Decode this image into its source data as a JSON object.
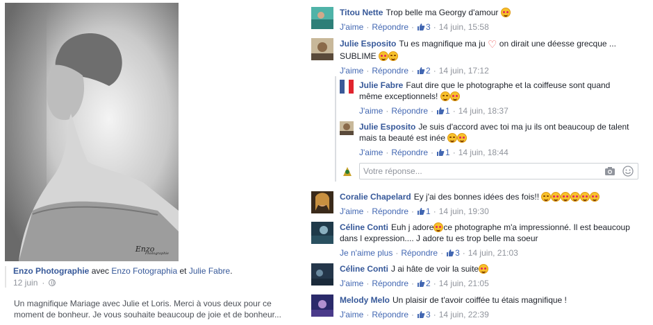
{
  "post": {
    "photo_signature": "Enzo",
    "photo_signature_small": "Photographie",
    "author": "Enzo Photographie",
    "with_word": "avec",
    "tag1": "Enzo Fotographia",
    "and_word": "et",
    "tag2": "Julie Fabre",
    "period": ".",
    "date": "12 juin",
    "text": "Un magnifique Mariage avec Julie et Loris. Merci à vous deux pour ce moment de bonheur. Je vous souhaite beaucoup de joie et de bonheur..."
  },
  "labels": {
    "like": "J'aime",
    "unlike": "Je n'aime plus",
    "reply": "Répondre",
    "dot": "·",
    "reply_placeholder": "Votre réponse..."
  },
  "comments": [
    {
      "name": "Titou Nette",
      "text": "Trop belle ma Georgy d'amour",
      "likes": "3",
      "time": "14 juin, 15:58"
    },
    {
      "name": "Julie Esposito",
      "text1": "Tu es magnifique ma ju",
      "text2": "on dirait une déesse grecque ...",
      "text3": "SUBLIME",
      "likes": "2",
      "time": "14 juin, 17:12"
    },
    {
      "name": "Julie Fabre",
      "text1": "Faut dire que le photographe et la coiffeuse sont quand",
      "text2": "même exceptionnels!",
      "likes": "1",
      "time": "14 juin, 18:37"
    },
    {
      "name": "Julie Esposito",
      "text1": "Je suis d'accord avec toi ma ju ils ont beaucoup de talent",
      "text2": "mais ta beauté est inée",
      "likes": "1",
      "time": "14 juin, 18:44"
    },
    {
      "name": "Coralie Chapelard",
      "text": "Ey j'ai des bonnes idées des fois!!",
      "likes": "1",
      "time": "14 juin, 19:30"
    },
    {
      "name": "Céline Conti",
      "text1": "Euh j adore",
      "text2": "ce photographe m'a impressionné. Il est beaucoup",
      "text3": "dans l expression.... J adore tu es trop belle ma soeur",
      "likes": "3",
      "time": "14 juin, 21:03"
    },
    {
      "name": "Céline Conti",
      "text": "J ai hâte de voir la suite",
      "likes": "2",
      "time": "14 juin, 21:05"
    },
    {
      "name": "Melody Melo",
      "text": "Un plaisir de t'avoir coiffée tu étais magnifique !",
      "likes": "3",
      "time": "14 juin, 22:39"
    }
  ],
  "colors": {
    "link": "#365899",
    "action": "#4267b2",
    "meta": "#90949c"
  }
}
